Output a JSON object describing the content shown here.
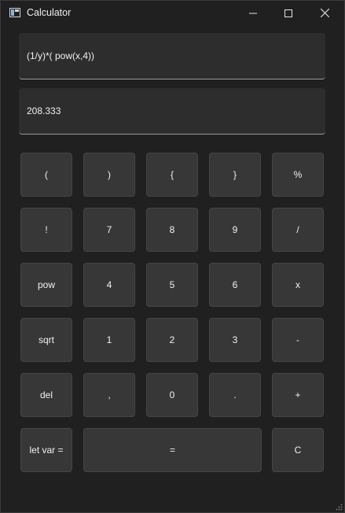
{
  "window": {
    "title": "Calculator",
    "controls": {
      "minimize": "minimize-icon",
      "maximize": "maximize-icon",
      "close": "close-icon"
    }
  },
  "expression": {
    "value": "(1/y)*( pow(x,4))"
  },
  "result": {
    "value": "208.333"
  },
  "keys": {
    "open_paren": "(",
    "close_paren": ")",
    "open_brace": "{",
    "close_brace": "}",
    "percent": "%",
    "factorial": "!",
    "seven": "7",
    "eight": "8",
    "nine": "9",
    "divide": "/",
    "pow": "pow",
    "four": "4",
    "five": "5",
    "six": "6",
    "multiply": "x",
    "sqrt": "sqrt",
    "one": "1",
    "two": "2",
    "three": "3",
    "minus": "-",
    "del": "del",
    "comma": ",",
    "zero": "0",
    "dot": ".",
    "plus": "+",
    "let_var": "let var =",
    "equals": "=",
    "clear": "C"
  },
  "colors": {
    "background": "#202020",
    "button": "#373737",
    "field": "#2d2d2d"
  }
}
